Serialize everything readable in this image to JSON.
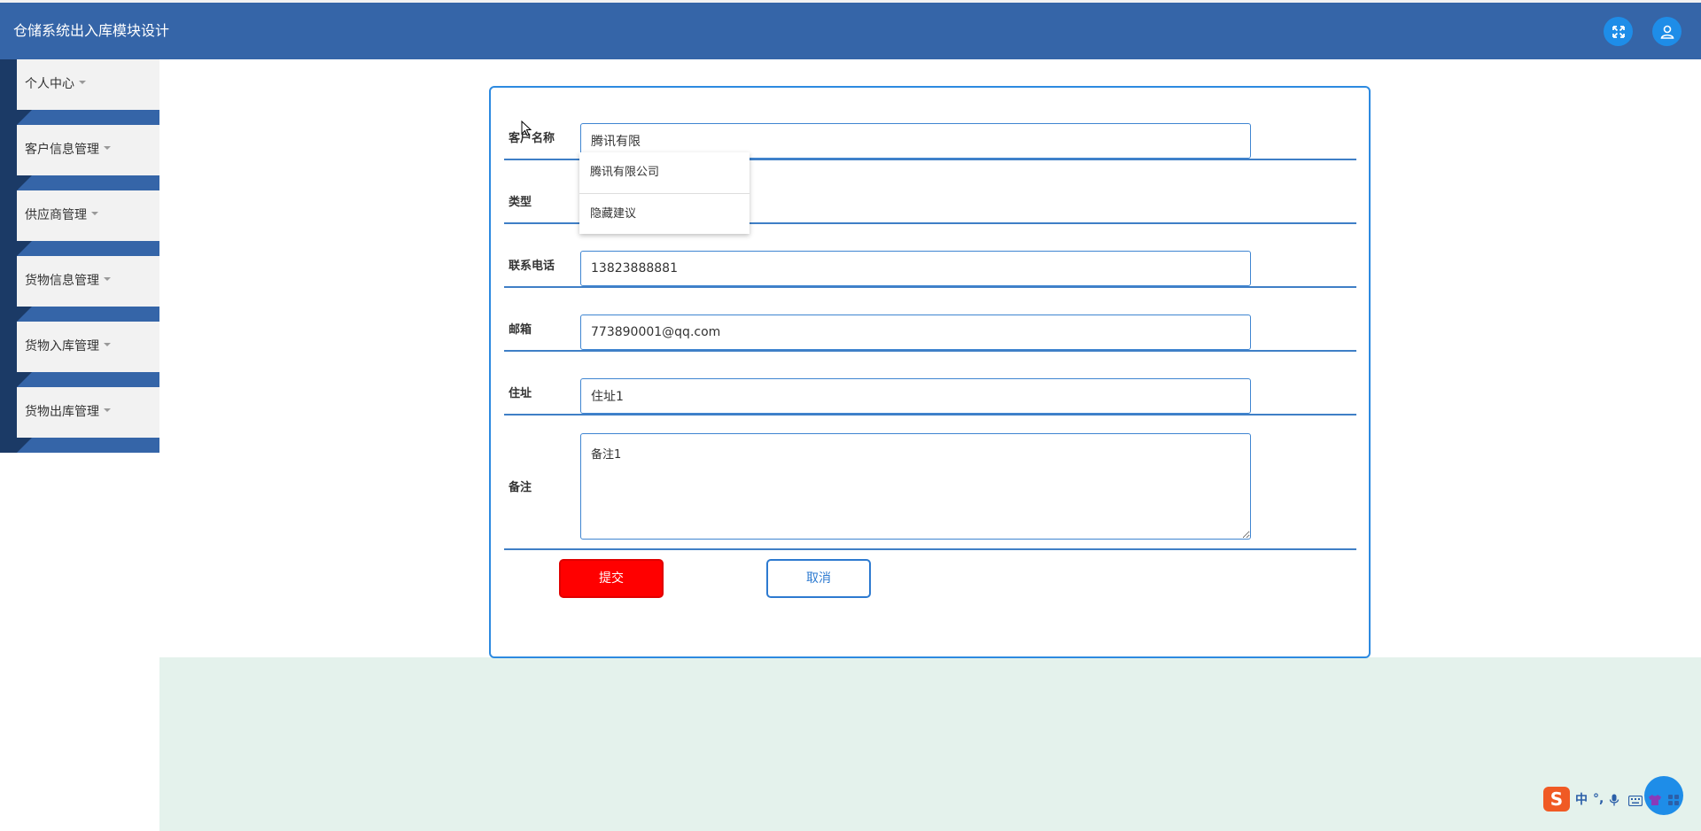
{
  "app": {
    "title": "仓储系统出入库模块设计"
  },
  "header": {
    "fullscreen_icon": "fullscreen-icon",
    "user_icon": "user-icon",
    "accent_color": "#3565a8"
  },
  "sidebar": {
    "items": [
      {
        "label": "个人中心"
      },
      {
        "label": "客户信息管理"
      },
      {
        "label": "供应商管理"
      },
      {
        "label": "货物信息管理"
      },
      {
        "label": "货物入库管理"
      },
      {
        "label": "货物出库管理"
      }
    ]
  },
  "form": {
    "name": {
      "label": "客户名称",
      "value": "腾讯有限"
    },
    "type": {
      "label": "类型"
    },
    "phone": {
      "label": "联系电话",
      "value": "13823888881"
    },
    "email": {
      "label": "邮箱",
      "value": "773890001@qq.com"
    },
    "address": {
      "label": "住址",
      "value": "住址1"
    },
    "remark": {
      "label": "备注",
      "value": "备注1"
    }
  },
  "autocomplete": {
    "options": [
      "腾讯有限公司",
      "隐藏建议"
    ]
  },
  "buttons": {
    "submit_label": "提交",
    "cancel_label": "取消",
    "submit_color": "#ff0000"
  },
  "ime": {
    "logo": "S",
    "mode": "中",
    "punct": "°,"
  }
}
